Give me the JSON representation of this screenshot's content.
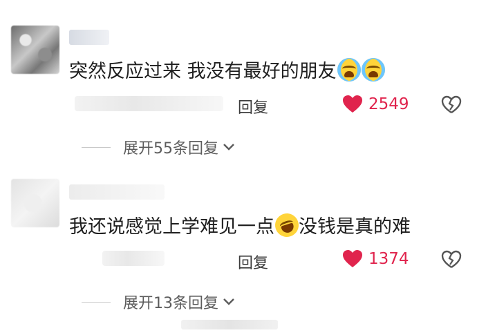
{
  "comments": [
    {
      "text": "突然反应过来 我没有最好的朋友",
      "emojis": [
        "crying-face-emoji",
        "crying-face-emoji"
      ],
      "reply_label": "回复",
      "like_count": "2549",
      "expand_label": "展开55条回复"
    },
    {
      "text": "我还说感觉上学难见一点",
      "emoji": "rolling-laughing-emoji",
      "text_after": "没钱是真的难",
      "reply_label": "回复",
      "like_count": "1374",
      "expand_label": "展开13条回复"
    }
  ],
  "colors": {
    "like_red": "#e0244d",
    "text": "#1f1f1f",
    "secondary": "#5c5c5c"
  },
  "icons": {
    "like": "heart-icon",
    "dislike": "broken-heart-icon",
    "expand": "chevron-down-icon"
  }
}
